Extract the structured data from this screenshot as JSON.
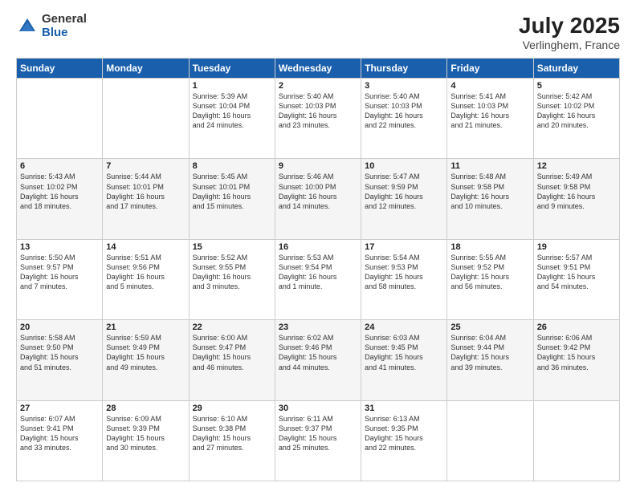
{
  "logo": {
    "general": "General",
    "blue": "Blue"
  },
  "header": {
    "month": "July 2025",
    "location": "Verlinghem, France"
  },
  "weekdays": [
    "Sunday",
    "Monday",
    "Tuesday",
    "Wednesday",
    "Thursday",
    "Friday",
    "Saturday"
  ],
  "weeks": [
    [
      {
        "day": "",
        "text": ""
      },
      {
        "day": "",
        "text": ""
      },
      {
        "day": "1",
        "text": "Sunrise: 5:39 AM\nSunset: 10:04 PM\nDaylight: 16 hours\nand 24 minutes."
      },
      {
        "day": "2",
        "text": "Sunrise: 5:40 AM\nSunset: 10:03 PM\nDaylight: 16 hours\nand 23 minutes."
      },
      {
        "day": "3",
        "text": "Sunrise: 5:40 AM\nSunset: 10:03 PM\nDaylight: 16 hours\nand 22 minutes."
      },
      {
        "day": "4",
        "text": "Sunrise: 5:41 AM\nSunset: 10:03 PM\nDaylight: 16 hours\nand 21 minutes."
      },
      {
        "day": "5",
        "text": "Sunrise: 5:42 AM\nSunset: 10:02 PM\nDaylight: 16 hours\nand 20 minutes."
      }
    ],
    [
      {
        "day": "6",
        "text": "Sunrise: 5:43 AM\nSunset: 10:02 PM\nDaylight: 16 hours\nand 18 minutes."
      },
      {
        "day": "7",
        "text": "Sunrise: 5:44 AM\nSunset: 10:01 PM\nDaylight: 16 hours\nand 17 minutes."
      },
      {
        "day": "8",
        "text": "Sunrise: 5:45 AM\nSunset: 10:01 PM\nDaylight: 16 hours\nand 15 minutes."
      },
      {
        "day": "9",
        "text": "Sunrise: 5:46 AM\nSunset: 10:00 PM\nDaylight: 16 hours\nand 14 minutes."
      },
      {
        "day": "10",
        "text": "Sunrise: 5:47 AM\nSunset: 9:59 PM\nDaylight: 16 hours\nand 12 minutes."
      },
      {
        "day": "11",
        "text": "Sunrise: 5:48 AM\nSunset: 9:58 PM\nDaylight: 16 hours\nand 10 minutes."
      },
      {
        "day": "12",
        "text": "Sunrise: 5:49 AM\nSunset: 9:58 PM\nDaylight: 16 hours\nand 9 minutes."
      }
    ],
    [
      {
        "day": "13",
        "text": "Sunrise: 5:50 AM\nSunset: 9:57 PM\nDaylight: 16 hours\nand 7 minutes."
      },
      {
        "day": "14",
        "text": "Sunrise: 5:51 AM\nSunset: 9:56 PM\nDaylight: 16 hours\nand 5 minutes."
      },
      {
        "day": "15",
        "text": "Sunrise: 5:52 AM\nSunset: 9:55 PM\nDaylight: 16 hours\nand 3 minutes."
      },
      {
        "day": "16",
        "text": "Sunrise: 5:53 AM\nSunset: 9:54 PM\nDaylight: 16 hours\nand 1 minute."
      },
      {
        "day": "17",
        "text": "Sunrise: 5:54 AM\nSunset: 9:53 PM\nDaylight: 15 hours\nand 58 minutes."
      },
      {
        "day": "18",
        "text": "Sunrise: 5:55 AM\nSunset: 9:52 PM\nDaylight: 15 hours\nand 56 minutes."
      },
      {
        "day": "19",
        "text": "Sunrise: 5:57 AM\nSunset: 9:51 PM\nDaylight: 15 hours\nand 54 minutes."
      }
    ],
    [
      {
        "day": "20",
        "text": "Sunrise: 5:58 AM\nSunset: 9:50 PM\nDaylight: 15 hours\nand 51 minutes."
      },
      {
        "day": "21",
        "text": "Sunrise: 5:59 AM\nSunset: 9:49 PM\nDaylight: 15 hours\nand 49 minutes."
      },
      {
        "day": "22",
        "text": "Sunrise: 6:00 AM\nSunset: 9:47 PM\nDaylight: 15 hours\nand 46 minutes."
      },
      {
        "day": "23",
        "text": "Sunrise: 6:02 AM\nSunset: 9:46 PM\nDaylight: 15 hours\nand 44 minutes."
      },
      {
        "day": "24",
        "text": "Sunrise: 6:03 AM\nSunset: 9:45 PM\nDaylight: 15 hours\nand 41 minutes."
      },
      {
        "day": "25",
        "text": "Sunrise: 6:04 AM\nSunset: 9:44 PM\nDaylight: 15 hours\nand 39 minutes."
      },
      {
        "day": "26",
        "text": "Sunrise: 6:06 AM\nSunset: 9:42 PM\nDaylight: 15 hours\nand 36 minutes."
      }
    ],
    [
      {
        "day": "27",
        "text": "Sunrise: 6:07 AM\nSunset: 9:41 PM\nDaylight: 15 hours\nand 33 minutes."
      },
      {
        "day": "28",
        "text": "Sunrise: 6:09 AM\nSunset: 9:39 PM\nDaylight: 15 hours\nand 30 minutes."
      },
      {
        "day": "29",
        "text": "Sunrise: 6:10 AM\nSunset: 9:38 PM\nDaylight: 15 hours\nand 27 minutes."
      },
      {
        "day": "30",
        "text": "Sunrise: 6:11 AM\nSunset: 9:37 PM\nDaylight: 15 hours\nand 25 minutes."
      },
      {
        "day": "31",
        "text": "Sunrise: 6:13 AM\nSunset: 9:35 PM\nDaylight: 15 hours\nand 22 minutes."
      },
      {
        "day": "",
        "text": ""
      },
      {
        "day": "",
        "text": ""
      }
    ]
  ]
}
